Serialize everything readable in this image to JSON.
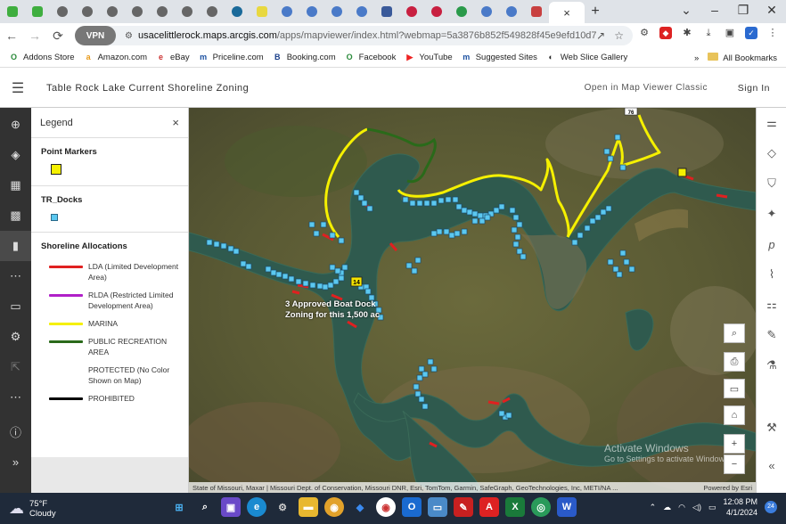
{
  "browser": {
    "tab_count": 20,
    "active_tab_close": "×",
    "new_tab": "+",
    "url_host": "usacelittlerock.maps.arcgis.com",
    "url_path": "/apps/mapviewer/index.html?webmap=5a3876b852f549828f45e9efd10d76a8",
    "vpn_label": "VPN",
    "bookmarks": [
      {
        "label": "Addons Store",
        "icon": "O",
        "color": "#2a8a3a"
      },
      {
        "label": "Amazon.com",
        "icon": "a",
        "color": "#e89a1a"
      },
      {
        "label": "eBay",
        "icon": "e",
        "color": "#c33"
      },
      {
        "label": "Priceline.com",
        "icon": "m",
        "color": "#1a4fa0"
      },
      {
        "label": "Booking.com",
        "icon": "B",
        "color": "#1a3f8a"
      },
      {
        "label": "Facebook",
        "icon": "O",
        "color": "#2a8a3a"
      },
      {
        "label": "YouTube",
        "icon": "▶",
        "color": "#e22"
      },
      {
        "label": "Suggested Sites",
        "icon": "m",
        "color": "#1a4fa0"
      },
      {
        "label": "Web Slice Gallery",
        "icon": "◐",
        "color": "#222"
      }
    ],
    "bookmarks_overflow": "»",
    "all_bookmarks": "All Bookmarks"
  },
  "app": {
    "title": "Table Rock Lake Current Shoreline Zoning",
    "open_classic": "Open in Map Viewer Classic",
    "sign_in": "Sign In"
  },
  "legend": {
    "title": "Legend",
    "close": "×",
    "point_markers": "Point Markers",
    "tr_docks": "TR_Docks",
    "shoreline_title": "Shoreline Allocations",
    "allocations": [
      {
        "label": "LDA (Limited Development Area)",
        "color": "#e02020"
      },
      {
        "label": "RLDA (Restricted Limited Development Area)",
        "color": "#b020c8"
      },
      {
        "label": "MARINA",
        "color": "#f5f000"
      },
      {
        "label": "PUBLIC RECREATION AREA",
        "color": "#2a6a1a"
      },
      {
        "label": "PROTECTED (No Color Shown on Map)",
        "color": "transparent"
      },
      {
        "label": "PROHIBITED",
        "color": "#000000"
      }
    ]
  },
  "map": {
    "annotation": "3 Approved Boat Dock Zoning for this 1,500 ac",
    "route_label_14": "14",
    "route_label_76": "76",
    "attribution": "State of Missouri, Maxar | Missouri Dept. of Conservation, Missouri DNR, Esri, TomTom, Garmin, SafeGraph, GeoTechnologies, Inc, METI/NA ...",
    "powered_by": "Powered by Esri",
    "watermark_title": "Activate Windows",
    "watermark_sub": "Go to Settings to activate Windows.",
    "zoom_in": "+",
    "zoom_out": "−"
  },
  "taskbar": {
    "temperature": "75°F",
    "weather": "Cloudy",
    "time": "12:08 PM",
    "date": "4/1/2024",
    "notifications": "24"
  }
}
